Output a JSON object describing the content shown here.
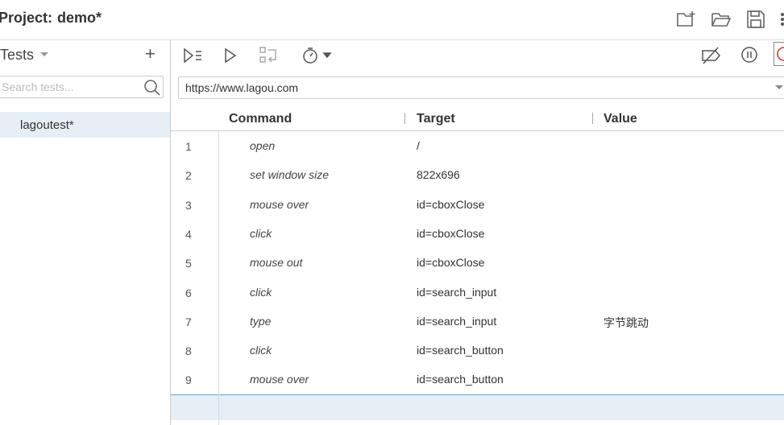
{
  "header": {
    "project_label": "Project:",
    "project_name": "demo*",
    "icons": [
      "new-folder-icon",
      "open-folder-icon",
      "save-icon",
      "more-icon"
    ]
  },
  "sidebar": {
    "title": "Tests",
    "add_label": "+",
    "search_placeholder": "Search tests...",
    "tests": [
      {
        "label": "lagoutest*",
        "selected": true
      }
    ]
  },
  "toolbar": {
    "icons": [
      "run-all-icon",
      "run-icon",
      "step-icon",
      "speed-timer-icon",
      "disable-breakpoints-icon",
      "pause-icon",
      "record-icon"
    ]
  },
  "url": {
    "value": "https://www.lagou.com"
  },
  "table": {
    "headers": {
      "command": "Command",
      "target": "Target",
      "value": "Value"
    },
    "rows": [
      {
        "num": "1",
        "command": "open",
        "target": "/",
        "value": ""
      },
      {
        "num": "2",
        "command": "set window size",
        "target": "822x696",
        "value": ""
      },
      {
        "num": "3",
        "command": "mouse over",
        "target": "id=cboxClose",
        "value": ""
      },
      {
        "num": "4",
        "command": "click",
        "target": "id=cboxClose",
        "value": ""
      },
      {
        "num": "5",
        "command": "mouse out",
        "target": "id=cboxClose",
        "value": ""
      },
      {
        "num": "6",
        "command": "click",
        "target": "id=search_input",
        "value": ""
      },
      {
        "num": "7",
        "command": "type",
        "target": "id=search_input",
        "value": "字节跳动"
      },
      {
        "num": "8",
        "command": "click",
        "target": "id=search_button",
        "value": ""
      },
      {
        "num": "9",
        "command": "mouse over",
        "target": "id=search_button",
        "value": ""
      }
    ]
  },
  "colors": {
    "selection": "#e6eef6",
    "accent_line": "#6aa0dc",
    "record": "#d9362b"
  }
}
